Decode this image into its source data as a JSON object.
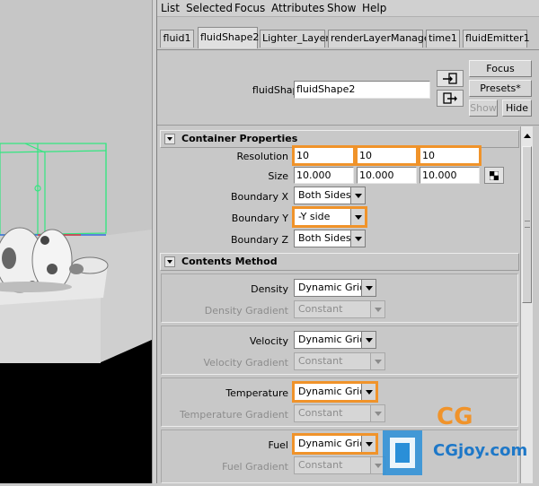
{
  "menubar": {
    "items": [
      "List",
      "Selected",
      "Focus",
      "Attributes",
      "Show",
      "Help"
    ]
  },
  "tabs": [
    {
      "label": "fluid1",
      "active": false
    },
    {
      "label": "fluidShape2",
      "active": true
    },
    {
      "label": "Lighter_Layer",
      "active": false
    },
    {
      "label": "renderLayerManager",
      "active": false
    },
    {
      "label": "time1",
      "active": false
    },
    {
      "label": "fluidEmitter1",
      "active": false
    }
  ],
  "header": {
    "node_label": "fluidShape:",
    "node_value": "fluidShape2",
    "buttons": {
      "focus": "Focus",
      "presets": "Presets*",
      "show": "Show",
      "hide": "Hide"
    },
    "icons": [
      "load-attributes-icon",
      "copy-tab-icon"
    ]
  },
  "container_properties": {
    "title": "Container Properties",
    "resolution": {
      "label": "Resolution",
      "values": [
        "10",
        "10",
        "10"
      ]
    },
    "size": {
      "label": "Size",
      "values": [
        "10.000",
        "10.000",
        "10.000"
      ]
    },
    "boundary_x": {
      "label": "Boundary X",
      "value": "Both Sides"
    },
    "boundary_y": {
      "label": "Boundary Y",
      "value": "-Y side"
    },
    "boundary_z": {
      "label": "Boundary Z",
      "value": "Both Sides"
    }
  },
  "contents_method": {
    "title": "Contents Method",
    "density": {
      "label": "Density",
      "value": "Dynamic Grid",
      "gradient_label": "Density Gradient",
      "gradient_value": "Constant"
    },
    "velocity": {
      "label": "Velocity",
      "value": "Dynamic Grid",
      "gradient_label": "Velocity Gradient",
      "gradient_value": "Constant"
    },
    "temperature": {
      "label": "Temperature",
      "value": "Dynamic Grid",
      "gradient_label": "Temperature Gradient",
      "gradient_value": "Constant"
    },
    "fuel": {
      "label": "Fuel",
      "value": "Dynamic Grid",
      "gradient_label": "Fuel Gradient",
      "gradient_value": "Constant"
    }
  },
  "watermark": {
    "line1": "CG",
    "line2": "CGjoy.com"
  },
  "colors": {
    "highlight": "#f0932a",
    "panel": "#c8c8c8",
    "viewport": "#000000",
    "grid_wire": "#33e680"
  }
}
